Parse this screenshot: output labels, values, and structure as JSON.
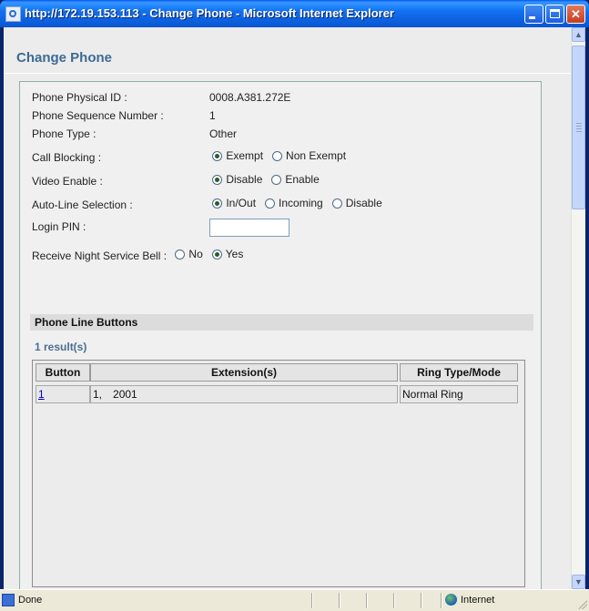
{
  "window": {
    "title": "http://172.19.153.113 - Change Phone - Microsoft Internet Explorer"
  },
  "page": {
    "title": "Change Phone"
  },
  "fields": {
    "physical_id_label": "Phone Physical ID :",
    "physical_id_value": "0008.A381.272E",
    "sequence_label": "Phone Sequence Number :",
    "sequence_value": "1",
    "type_label": "Phone Type :",
    "type_value": "Other",
    "call_blocking_label": "Call Blocking :",
    "call_blocking_options": [
      "Exempt",
      "Non Exempt"
    ],
    "call_blocking_selected": "Exempt",
    "video_label": "Video Enable :",
    "video_options": [
      "Disable",
      "Enable"
    ],
    "video_selected": "Disable",
    "auto_line_label": "Auto-Line Selection :",
    "auto_line_options": [
      "In/Out",
      "Incoming",
      "Disable"
    ],
    "auto_line_selected": "In/Out",
    "login_pin_label": "Login PIN :",
    "login_pin_value": "",
    "night_bell_label": "Receive Night Service Bell :",
    "night_bell_options": [
      "No",
      "Yes"
    ],
    "night_bell_selected": "Yes"
  },
  "line_buttons": {
    "section_title": "Phone Line Buttons",
    "results": "1 result(s)",
    "columns": [
      "Button",
      "Extension(s)",
      "Ring Type/Mode"
    ],
    "rows": [
      {
        "button": "1",
        "ext_index": "1,",
        "ext_number": "2001",
        "ring": "Normal Ring"
      }
    ]
  },
  "statusbar": {
    "status": "Done",
    "zone": "Internet"
  },
  "icons": {
    "titlebar": "ie-page-icon",
    "status": "ie-page-icon",
    "zone": "globe-icon"
  }
}
